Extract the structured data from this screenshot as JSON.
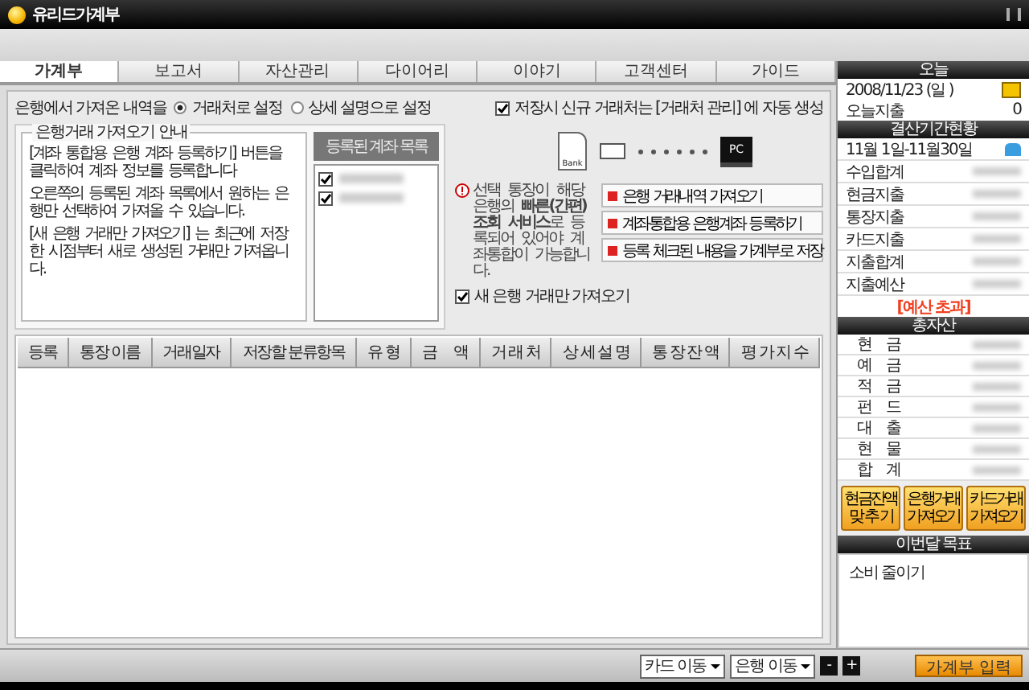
{
  "window": {
    "title": "유리드가계부"
  },
  "tabs": [
    {
      "label": "가계부",
      "selected": true
    },
    {
      "label": "보고서",
      "selected": false
    },
    {
      "label": "자산관리",
      "selected": false
    },
    {
      "label": "다이어리",
      "selected": false
    },
    {
      "label": "이야기",
      "selected": false
    },
    {
      "label": "고객센터",
      "selected": false
    },
    {
      "label": "가이드",
      "selected": false
    }
  ],
  "import_options": {
    "label": "은행에서 가져온 내역을",
    "radios": [
      {
        "label": "거래처로 설정",
        "selected": true
      },
      {
        "label": "상세 설명으로 설정",
        "selected": false
      }
    ],
    "auto_create": {
      "label": "저장시 신규 거래처는 [거래처 관리] 에 자동 생성",
      "checked": true
    }
  },
  "guide": {
    "title": "은행거래 가져오기 안내",
    "paragraphs": [
      "[계좌 통합용 은행 계좌 등록하기] 버튼을 클릭하여 계좌 정보를 등록합니다",
      "오른쪽의 등록된 계좌 목록에서 원하는 은행만 선택하여 가져올 수 있습니다.",
      "[새 은행 거래만 가져오기] 는 최근에 저장한 시점부터 새로 생성된 거래만 가져옵니다."
    ]
  },
  "accounts": {
    "title": "등록된 계좌 목록",
    "items": [
      {
        "checked": true
      },
      {
        "checked": true
      }
    ]
  },
  "diagram": {
    "bank_label": "Bank",
    "pc_label": "PC"
  },
  "notice": "선택 통장이 해당은행의 **빠른(간편)조회 서비스**로 등록되어 있어야 계좌통합이 가능합니다.",
  "new_only": {
    "label": "새 은행 거래만 가져오기",
    "checked": true
  },
  "actions": [
    "은행 거래내역 가져오기",
    "계좌통합용 은행계좌 등록하기",
    "등록 체크된 내용을 가계부로 저장"
  ],
  "table": {
    "columns": [
      "등록",
      "통장 이름",
      "거래일자",
      "저장할 분류항목",
      "유 형",
      "금　 액",
      "거 래 처",
      "상 세 설 명",
      "통 장 잔 액",
      "평 가 지 수"
    ]
  },
  "bottom_bar": {
    "selects": [
      {
        "value": "카드 이동"
      },
      {
        "value": "은행 이동"
      }
    ],
    "zoom_buttons": [
      "-",
      "+"
    ],
    "submit": "가계부 입력"
  },
  "sidebar": {
    "today": {
      "title": "오늘",
      "date": "2008/11/23 (일 )",
      "spend_label": "오늘지출",
      "spend_value": "0"
    },
    "period": {
      "title": "결산기간현황",
      "range": "11월 1일-11월30일",
      "rows": [
        "수입합계",
        "현금지출",
        "통장지출",
        "카드지출",
        "지출합계",
        "지출예산"
      ],
      "alert": "[예산 초과]"
    },
    "assets": {
      "title": "총자산",
      "rows": [
        "현　금",
        "예　금",
        "적　금",
        "펀　드",
        "대　출",
        "현　물",
        "합　계"
      ]
    },
    "buttons": [
      [
        "현금잔액",
        "맞 추 기"
      ],
      [
        "은행거래",
        "가져오기"
      ],
      [
        "카드거래",
        "가져오기"
      ]
    ],
    "goal": {
      "title": "이번달 목표",
      "text": "소비 줄이기"
    }
  }
}
